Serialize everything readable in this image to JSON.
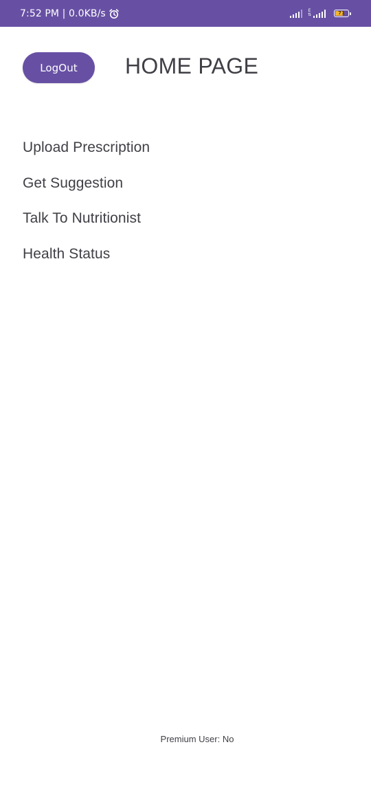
{
  "status_bar": {
    "time": "7:52 PM | 0.0KB/s",
    "alarm_icon": "alarm-clock-icon",
    "network_type": "E",
    "battery_level": "71",
    "battery_fraction": 0.71,
    "background_color": "#6750a4"
  },
  "header": {
    "logout_label": "LogOut",
    "title": "HOME PAGE"
  },
  "menu": {
    "items": [
      {
        "label": "Upload Prescription"
      },
      {
        "label": "Get Suggestion"
      },
      {
        "label": "Talk To Nutritionist"
      },
      {
        "label": "Health Status"
      }
    ]
  },
  "footer": {
    "premium_status": "Premium User: No"
  },
  "colors": {
    "accent": "#6750a4",
    "text": "#3f3f46",
    "battery": "#f2b431"
  }
}
